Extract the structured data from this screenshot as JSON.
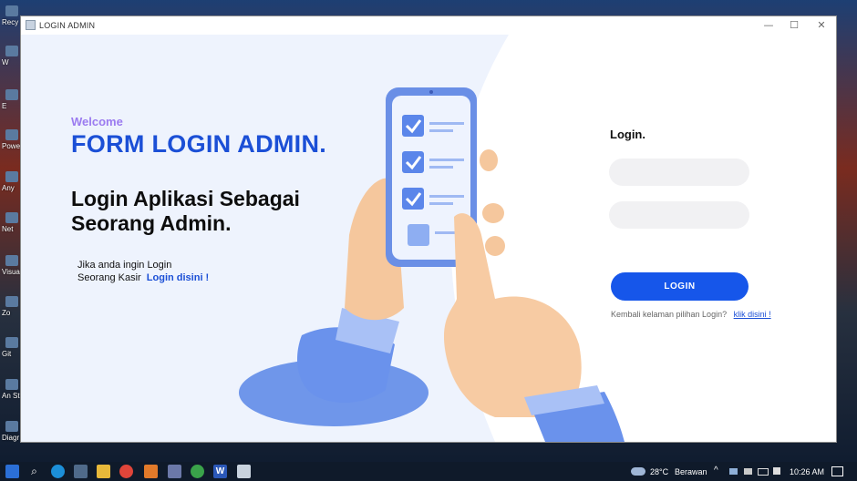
{
  "window": {
    "title": "LOGIN ADMIN",
    "minimize": "—",
    "maximize": "☐",
    "close": "✕"
  },
  "left": {
    "welcome": "Welcome",
    "form_title": "FORM LOGIN ADMIN.",
    "subtitle_line1": "Login Aplikasi Sebagai",
    "subtitle_line2": "Seorang Admin.",
    "kasir_line1": "Jika anda ingin Login",
    "kasir_line2": "Seorang Kasir",
    "kasir_link": "Login disini !"
  },
  "form": {
    "heading": "Login.",
    "username_value": "",
    "password_value": "",
    "login_button": "LOGIN",
    "back_text": "Kembali kelaman pilihan Login?",
    "back_link": "klik disini !"
  },
  "desktop_icons": [
    "Recy",
    "W",
    "E",
    "Powe",
    "Any",
    "Net",
    "Visua C",
    "Zo",
    "Git",
    "An St",
    "Diagr"
  ],
  "taskbar": {
    "weather_temp": "28°C",
    "weather_text": "Berawan",
    "time": "10:26 AM"
  },
  "colors": {
    "accent": "#1b4fd6",
    "welcome": "#9b7bf0",
    "button": "#1656ea",
    "panel_bg": "#eef3fd"
  }
}
